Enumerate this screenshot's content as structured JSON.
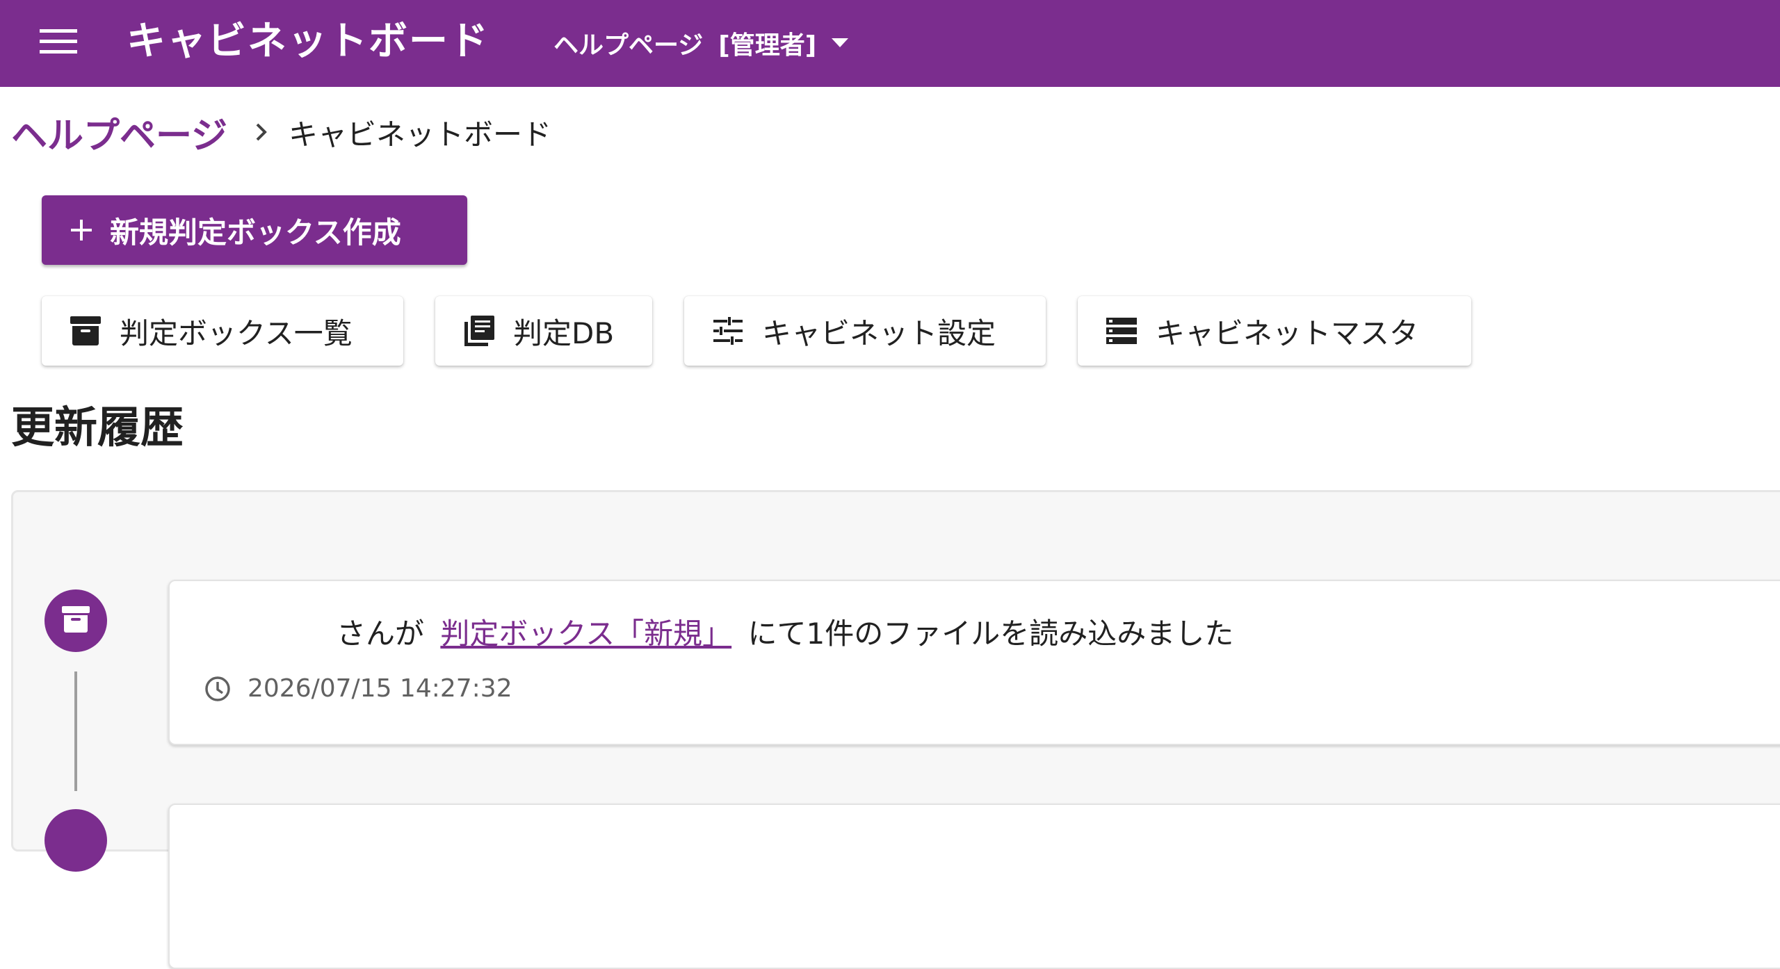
{
  "colors": {
    "primary": "#7b2d8e",
    "appbar_text": "#ffffff",
    "panel_bg": "#f7f7f7"
  },
  "appbar": {
    "menu_icon": "hamburger-menu-icon",
    "title": "キャビネットボード",
    "workspace": {
      "name": "ヘルプページ",
      "role": "[管理者]",
      "caret_icon": "arrow-drop-down-icon"
    }
  },
  "breadcrumb": {
    "parent": "ヘルプページ",
    "separator_icon": "chevron-right-icon",
    "current": "キャビネットボード"
  },
  "actions": {
    "create_box": {
      "icon": "plus-icon",
      "label": "新規判定ボックス作成"
    },
    "nav": [
      {
        "icon": "archive-box-icon",
        "label": "判定ボックス一覧"
      },
      {
        "icon": "library-books-icon",
        "label": "判定DB"
      },
      {
        "icon": "tune-sliders-icon",
        "label": "キャビネット設定"
      },
      {
        "icon": "storage-list-icon",
        "label": "キャビネットマスタ"
      }
    ]
  },
  "history": {
    "title": "更新履歴",
    "entries": [
      {
        "icon": "archive-box-icon",
        "message_prefix": "さんが",
        "link_text": "判定ボックス「新規」",
        "message_suffix": "にて1件のファイルを読み込みました",
        "timestamp": "2026/07/15 14:27:32",
        "time_icon": "clock-icon"
      }
    ]
  }
}
